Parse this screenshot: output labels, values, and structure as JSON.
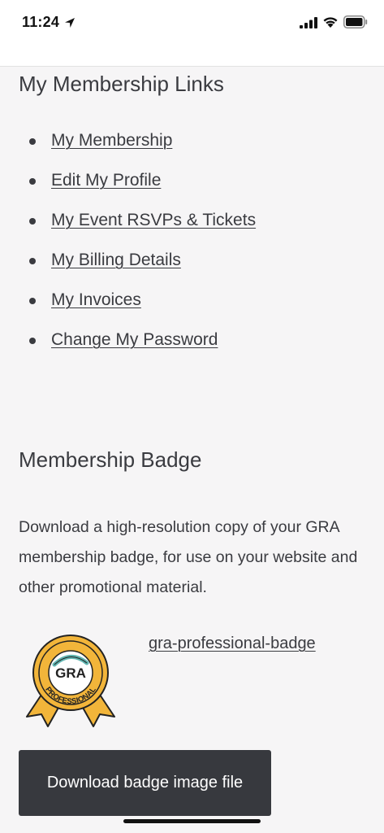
{
  "status_bar": {
    "time": "11:24"
  },
  "membership_links": {
    "heading": "My Membership Links",
    "items": [
      {
        "label": "My Membership"
      },
      {
        "label": "Edit My Profile"
      },
      {
        "label": "My Event RSVPs & Tickets"
      },
      {
        "label": "My Billing Details"
      },
      {
        "label": "My Invoices"
      },
      {
        "label": "Change My Password"
      }
    ]
  },
  "badge_section": {
    "heading": "Membership Badge",
    "description": "Download a high-resolution copy of your GRA membership badge, for use on your website and other promotional material.",
    "badge_text_top": "GRA",
    "badge_text_ring": "PROFESSIONAL",
    "link_text": "gra-professional-badge",
    "download_button": "Download badge image file"
  },
  "colors": {
    "background": "#f6f5f6",
    "text": "#3a3b40",
    "button": "#37393e",
    "badge_gold": "#f2b53a",
    "badge_teal": "#5fb4b0"
  }
}
